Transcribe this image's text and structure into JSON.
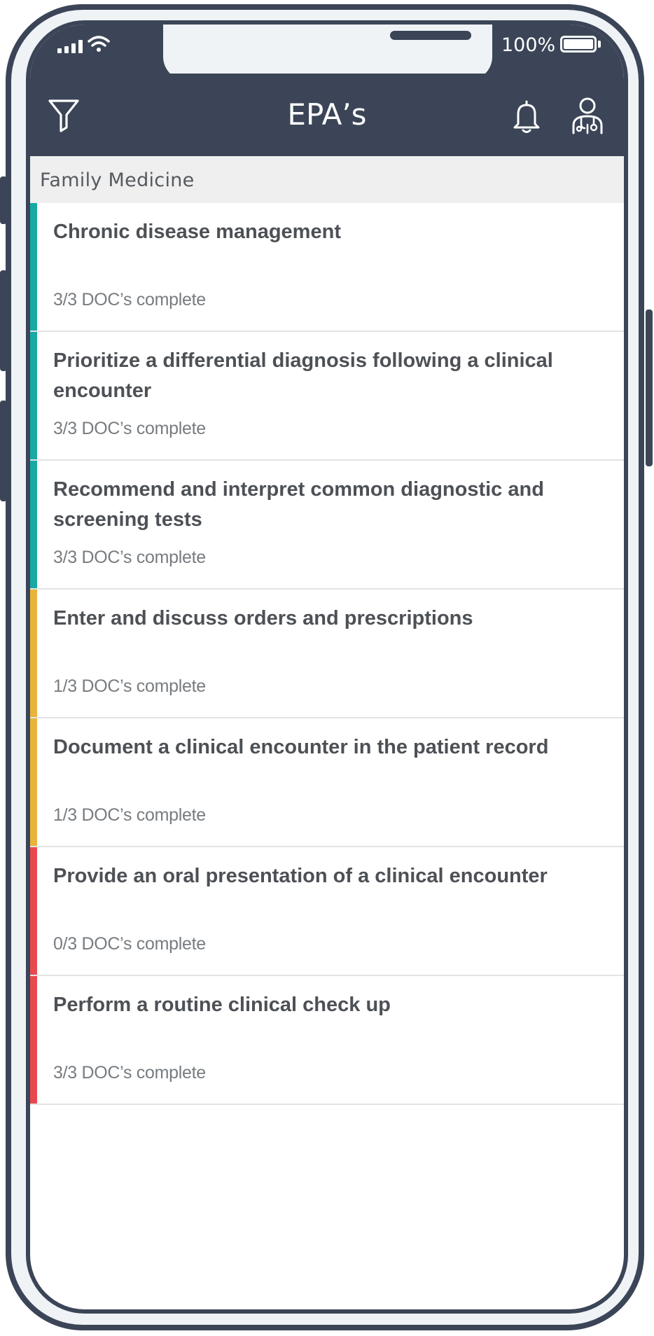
{
  "status_bar": {
    "battery_percent": "100%",
    "signal_icon": "signal-icon",
    "wifi_icon": "wifi-icon",
    "battery_icon": "battery-icon"
  },
  "header": {
    "title": "EPA’s",
    "filter_icon": "filter-icon",
    "notifications_icon": "bell-icon",
    "profile_icon": "doctor-profile-icon",
    "background_color": "#3b4557"
  },
  "section": {
    "title": "Family Medicine"
  },
  "status_colors": {
    "complete": "#17a9a4",
    "partial": "#e9b43a",
    "none": "#e8494f"
  },
  "epas": [
    {
      "title": "Chronic disease management",
      "status": "3/3 DOC’s complete",
      "color": "#17a9a4"
    },
    {
      "title": "Prioritize a differential diagnosis following a clinical encounter",
      "status": "3/3 DOC’s complete",
      "color": "#17a9a4"
    },
    {
      "title": "Recommend and interpret common diagnostic and screening tests",
      "status": "3/3 DOC’s complete",
      "color": "#17a9a4"
    },
    {
      "title": "Enter and discuss orders and prescriptions",
      "status": "1/3 DOC’s complete",
      "color": "#e9b43a"
    },
    {
      "title": "Document a clinical encounter in the patient record",
      "status": "1/3 DOC’s complete",
      "color": "#e9b43a"
    },
    {
      "title": "Provide an oral presentation of a clinical encounter",
      "status": "0/3 DOC’s complete",
      "color": "#e8494f"
    },
    {
      "title": "Perform a routine clinical check up",
      "status": "3/3 DOC’s complete",
      "color": "#e8494f"
    }
  ]
}
